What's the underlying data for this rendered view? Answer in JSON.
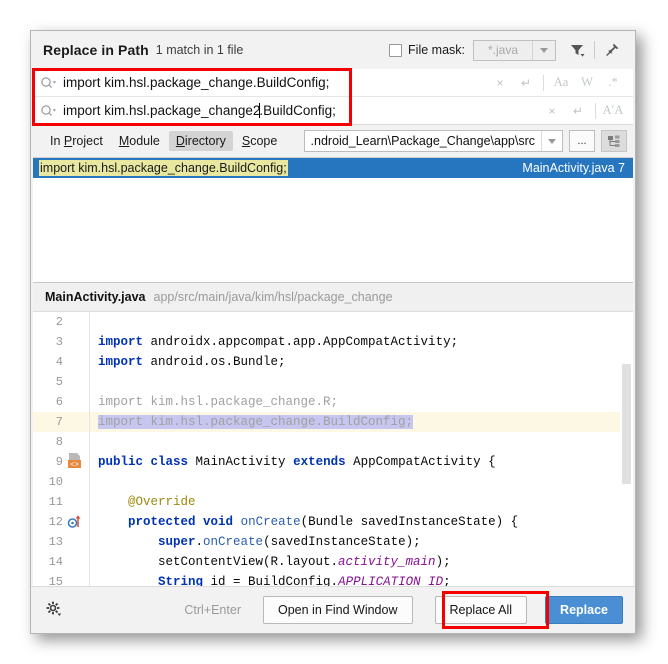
{
  "dialog": {
    "title": "Replace in Path",
    "subtitle": "1 match in 1 file"
  },
  "header": {
    "file_mask_label": "File mask:",
    "file_mask_value": "*.java",
    "file_mask_checked": false,
    "filter_icon": "filter-icon",
    "pin_icon": "pin-icon"
  },
  "search_field": {
    "value": "import kim.hsl.package_change.BuildConfig;",
    "icon": "search-icon",
    "actions": {
      "clear": "×",
      "history": "↵",
      "match_case": "Aa",
      "words": "W",
      "regex": ".*"
    }
  },
  "replace_field": {
    "value_before_caret": "import kim.hsl.package_change2",
    "value_after_caret": ".BuildConfig;",
    "full_value": "import kim.hsl.package_change2.BuildConfig;",
    "icon": "search-icon",
    "actions": {
      "clear": "×",
      "history": "↵",
      "preserve_case": "AʹA"
    }
  },
  "scope": {
    "tabs": [
      {
        "label": "In Project",
        "active": false
      },
      {
        "label": "Module",
        "active": false
      },
      {
        "label": "Directory",
        "active": true
      },
      {
        "label": "Scope",
        "active": false
      }
    ],
    "path_value": ".ndroid_Learn\\Package_Change\\app\\src",
    "browse_label": "...",
    "module_icon": "project-tree-icon"
  },
  "results": {
    "rows": [
      {
        "match_text": "import kim.hsl.package_change.BuildConfig;",
        "file": "MainActivity.java 7",
        "selected": true
      }
    ]
  },
  "preview": {
    "file_name": "MainActivity.java",
    "file_path": "app/src/main/java/kim/hsl/package_change",
    "lines": [
      {
        "no": "2",
        "text": "",
        "gutter": "",
        "highlight": false
      },
      {
        "no": "3",
        "text": "import androidx.appcompat.app.AppCompatActivity;",
        "gutter": "",
        "highlight": false
      },
      {
        "no": "4",
        "text": "import android.os.Bundle;",
        "gutter": "",
        "highlight": false
      },
      {
        "no": "5",
        "text": "",
        "gutter": "",
        "highlight": false
      },
      {
        "no": "6",
        "text": "import kim.hsl.package_change.R;",
        "gutter": "",
        "highlight": false
      },
      {
        "no": "7",
        "text": "import kim.hsl.package_change.BuildConfig;",
        "gutter": "",
        "highlight": true
      },
      {
        "no": "8",
        "text": "",
        "gutter": "",
        "highlight": false
      },
      {
        "no": "9",
        "text": "public class MainActivity extends AppCompatActivity {",
        "gutter": "class-marker-icon",
        "highlight": false
      },
      {
        "no": "10",
        "text": "",
        "gutter": "",
        "highlight": false
      },
      {
        "no": "11",
        "text": "    @Override",
        "gutter": "",
        "highlight": false
      },
      {
        "no": "12",
        "text": "    protected void onCreate(Bundle savedInstanceState) {",
        "gutter": "override-marker-icon",
        "highlight": false
      },
      {
        "no": "13",
        "text": "        super.onCreate(savedInstanceState);",
        "gutter": "",
        "highlight": false
      },
      {
        "no": "14",
        "text": "        setContentView(R.layout.activity_main);",
        "gutter": "",
        "highlight": false
      },
      {
        "no": "15",
        "text": "        String id = BuildConfig.APPLICATION_ID;",
        "gutter": "",
        "highlight": false
      }
    ]
  },
  "footer": {
    "settings_icon": "gear-icon",
    "shortcut": "Ctrl+Enter",
    "open_in_find_window": "Open in Find Window",
    "replace_all": "Replace All",
    "replace": "Replace"
  },
  "colors": {
    "accent_blue": "#2675bf",
    "primary_button": "#4a8fd4",
    "annotation_red": "#f40000",
    "match_highlight": "#e8e8a0",
    "line_highlight": "#fdf8e3",
    "selection_lavender": "#c6c6f0"
  }
}
